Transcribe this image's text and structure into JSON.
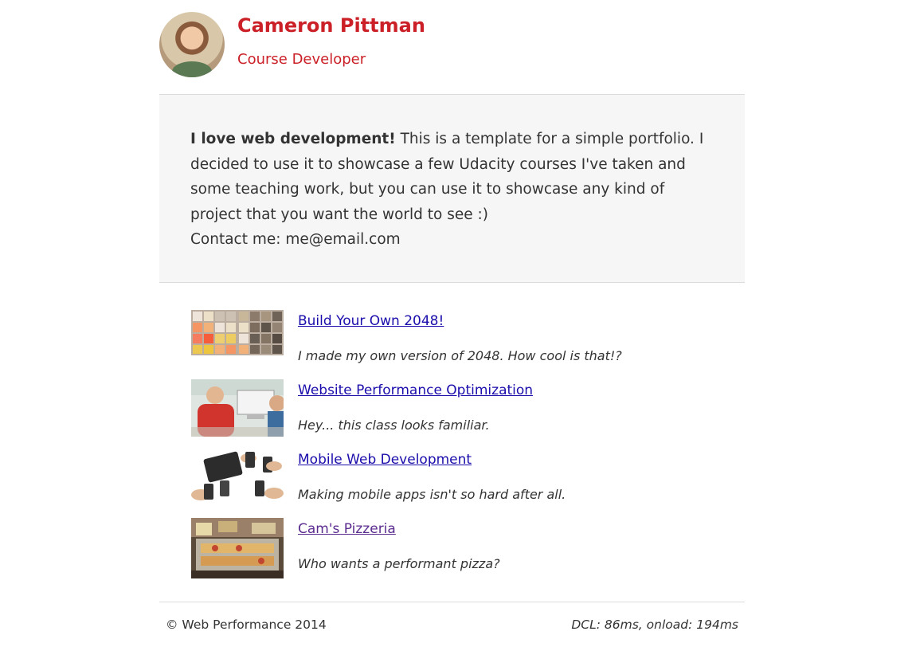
{
  "profile": {
    "name": "Cameron Pittman",
    "role": "Course Developer"
  },
  "about": {
    "lead": "I love web development!",
    "body": " This is a template for a simple portfolio. I decided to use it to showcase a few Udacity courses I've taken and some teaching work, but you can use it to showcase any kind of project that you want the world to see :)",
    "contact": "Contact me: me@email.com"
  },
  "projects": [
    {
      "title": "Build Your Own 2048!",
      "desc": "I made my own version of 2048. How cool is that!?"
    },
    {
      "title": "Website Performance Optimization",
      "desc": "Hey... this class looks familiar."
    },
    {
      "title": "Mobile Web Development",
      "desc": "Making mobile apps isn't so hard after all."
    },
    {
      "title": "Cam's Pizzeria",
      "desc": "Who wants a performant pizza?"
    }
  ],
  "footer": {
    "copyright": "© Web Performance 2014",
    "perf": "DCL: 86ms, onload: 194ms"
  },
  "colors": {
    "accent": "#cb2027",
    "link": "#1a0dab",
    "visited_link": "#5b2c8f",
    "about_bg": "#f6f6f6"
  }
}
